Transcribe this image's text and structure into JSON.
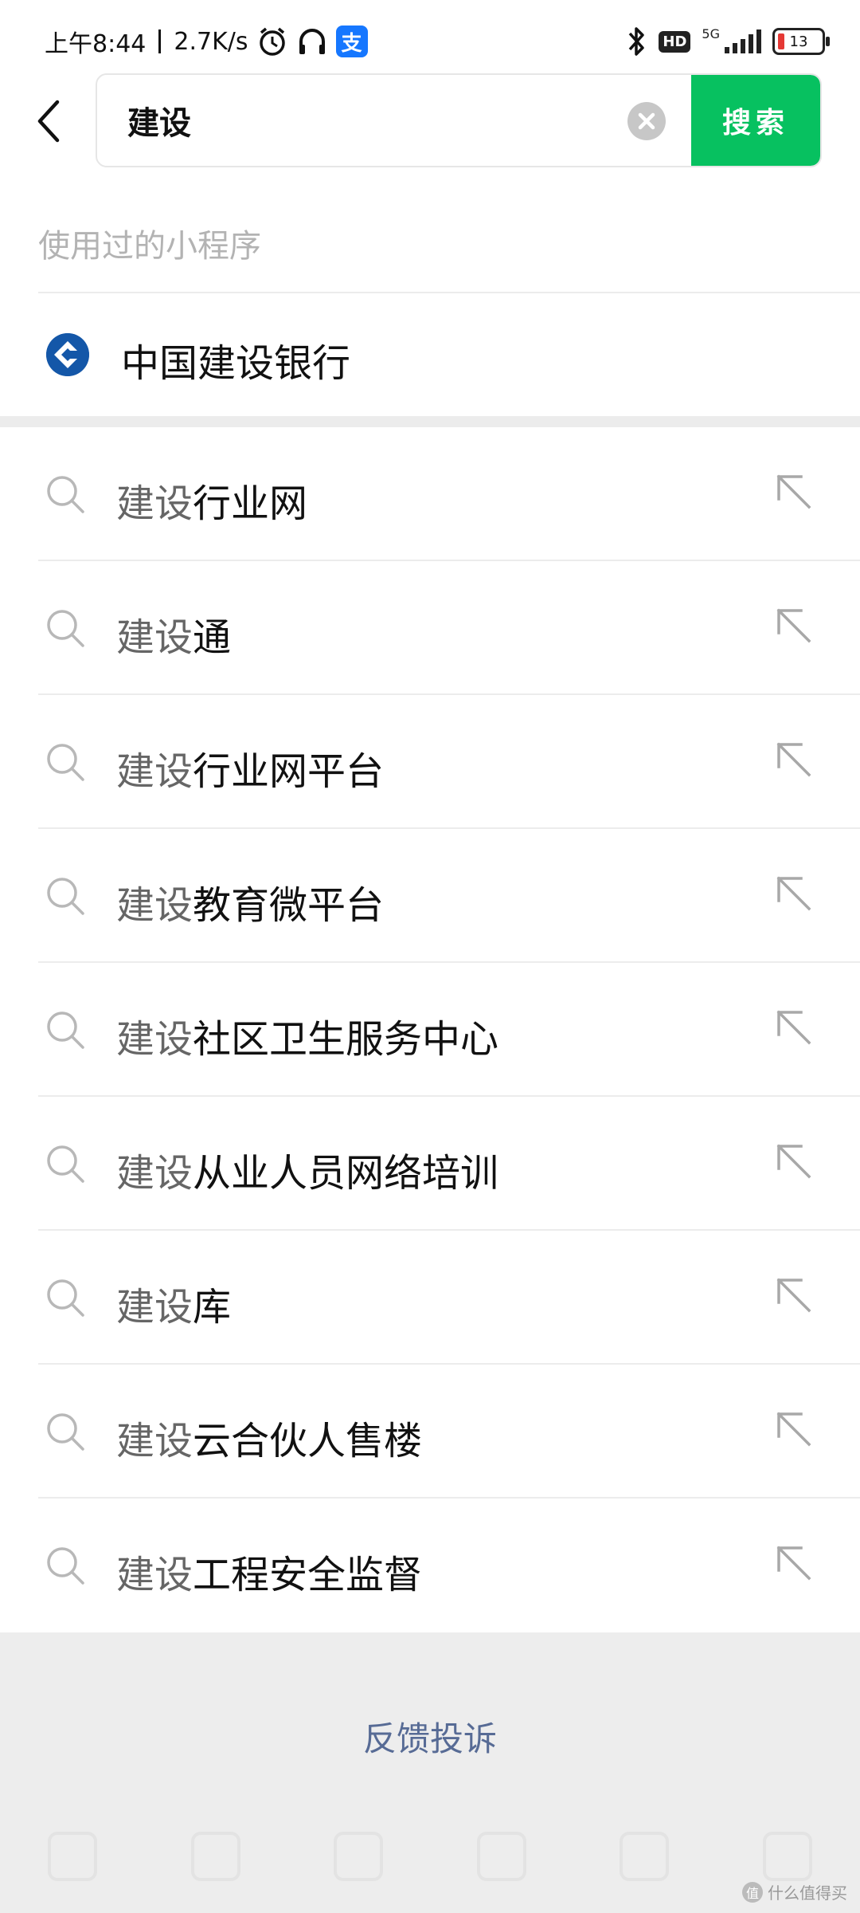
{
  "status_bar": {
    "time": "上午8:44",
    "network_speed": "2.7K/s",
    "hd_label": "HD",
    "network_type": "5G",
    "battery_level": "13",
    "icons": [
      "alarm-icon",
      "headphones-icon",
      "alipay-icon",
      "bluetooth-icon",
      "hd-icon",
      "signal-icon",
      "battery-icon"
    ],
    "alipay_glyph": "支"
  },
  "search": {
    "query": "建设",
    "button_label": "搜索"
  },
  "used_mini_programs": {
    "title": "使用过的小程序",
    "items": [
      {
        "name": "中国建设银行",
        "icon": "ccb-logo"
      }
    ]
  },
  "suggestions": [
    {
      "keyword": "建设",
      "suffix": "行业网"
    },
    {
      "keyword": "建设",
      "suffix": "通"
    },
    {
      "keyword": "建设",
      "suffix": "行业网平台"
    },
    {
      "keyword": "建设",
      "suffix": "教育微平台"
    },
    {
      "keyword": "建设",
      "suffix": "社区卫生服务中心"
    },
    {
      "keyword": "建设",
      "suffix": "从业人员网络培训"
    },
    {
      "keyword": "建设",
      "suffix": "库"
    },
    {
      "keyword": "建设",
      "suffix": "云合伙人售楼"
    },
    {
      "keyword": "建设",
      "suffix": "工程安全监督"
    }
  ],
  "footer": {
    "feedback_label": "反馈投诉",
    "watermark_logo": "值",
    "watermark_text": "什么值得买"
  },
  "colors": {
    "accent_green": "#07c160",
    "link_blue": "#576b95",
    "ccb_blue": "#1457a8"
  }
}
